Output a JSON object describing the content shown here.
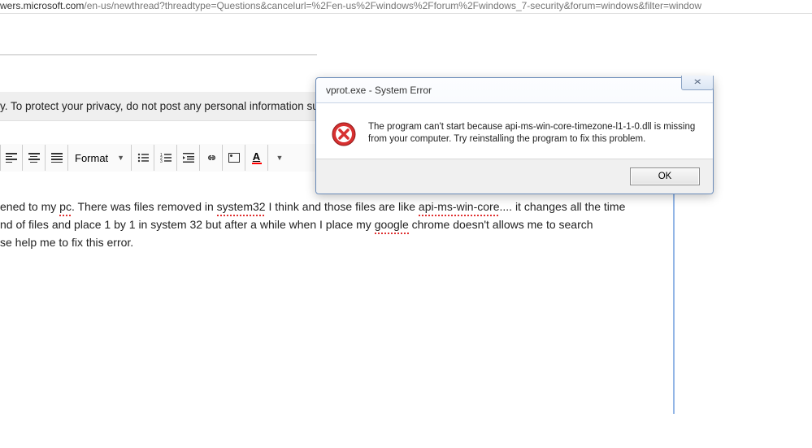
{
  "url": {
    "prefix_visible": "wers.microsoft.com",
    "path": "/en-us/newthread?threadtype=Questions&cancelurl=%2Fen-us%2Fwindows%2Fforum%2Fwindows_7-security&forum=windows&filter=window"
  },
  "privacy_text": "y. To protect your privacy, do not post any personal information su",
  "toolbar": {
    "format_label": "Format"
  },
  "editor": {
    "line1_a": "ened to my ",
    "line1_sp1": "pc",
    "line1_b": ". There was files removed in ",
    "line1_sp2": "system32",
    "line1_c": " I think and those files are like ",
    "line1_sp3": "api-ms-win-core",
    "line1_d": ".... it changes all the time",
    "line2_a": "nd of files and place 1 by 1 in system 32 but after a while when I place my ",
    "line2_sp1": "google",
    "line2_b": " chrome doesn't allows me to search",
    "line3": "se help me to fix this error."
  },
  "dialog": {
    "title": "vprot.exe - System Error",
    "message": "The program can't start because api-ms-win-core-timezone-l1-1-0.dll is missing from your computer. Try reinstalling the program to fix this problem.",
    "ok_label": "OK",
    "close_glyph": "✕"
  }
}
